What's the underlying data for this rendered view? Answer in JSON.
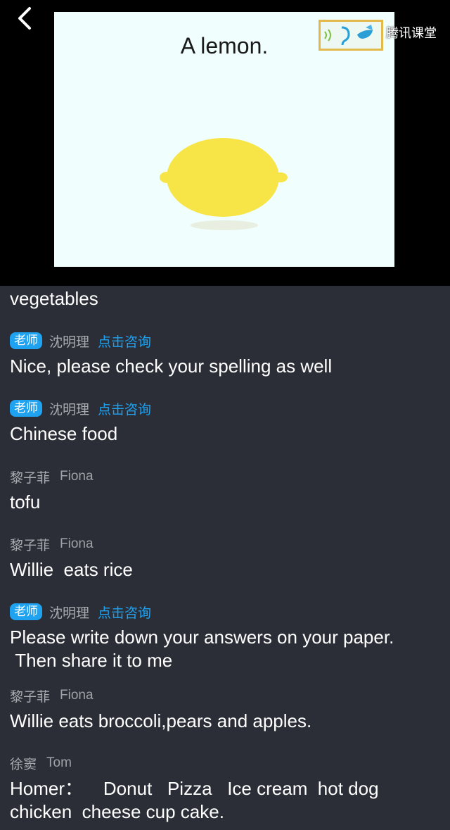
{
  "slide": {
    "title": "A lemon."
  },
  "logo": {
    "text": "腾讯课堂"
  },
  "chat": {
    "first_line": "vegetables",
    "messages": [
      {
        "badge": "老师",
        "name": "沈明理",
        "consult": "点击咨询",
        "text": "Nice, please check your spelling as well"
      },
      {
        "badge": "老师",
        "name": "沈明理",
        "consult": "点击咨询",
        "text": "Chinese food"
      },
      {
        "name": "黎子菲",
        "en_name": "Fiona",
        "text": "tofu"
      },
      {
        "name": "黎子菲",
        "en_name": "Fiona",
        "text": "Willie  eats rice"
      },
      {
        "badge": "老师",
        "name": "沈明理",
        "consult": "点击咨询",
        "text": "Please write down your answers on your paper.\n Then share it to me"
      },
      {
        "name": "黎子菲",
        "en_name": "Fiona",
        "text": "Willie eats broccoli,pears and apples."
      },
      {
        "name": "徐窦",
        "en_name": "Tom",
        "text": "Homer：    Donut   Pizza   Ice cream  hot dog\nchicken  cheese cup cake."
      }
    ]
  }
}
